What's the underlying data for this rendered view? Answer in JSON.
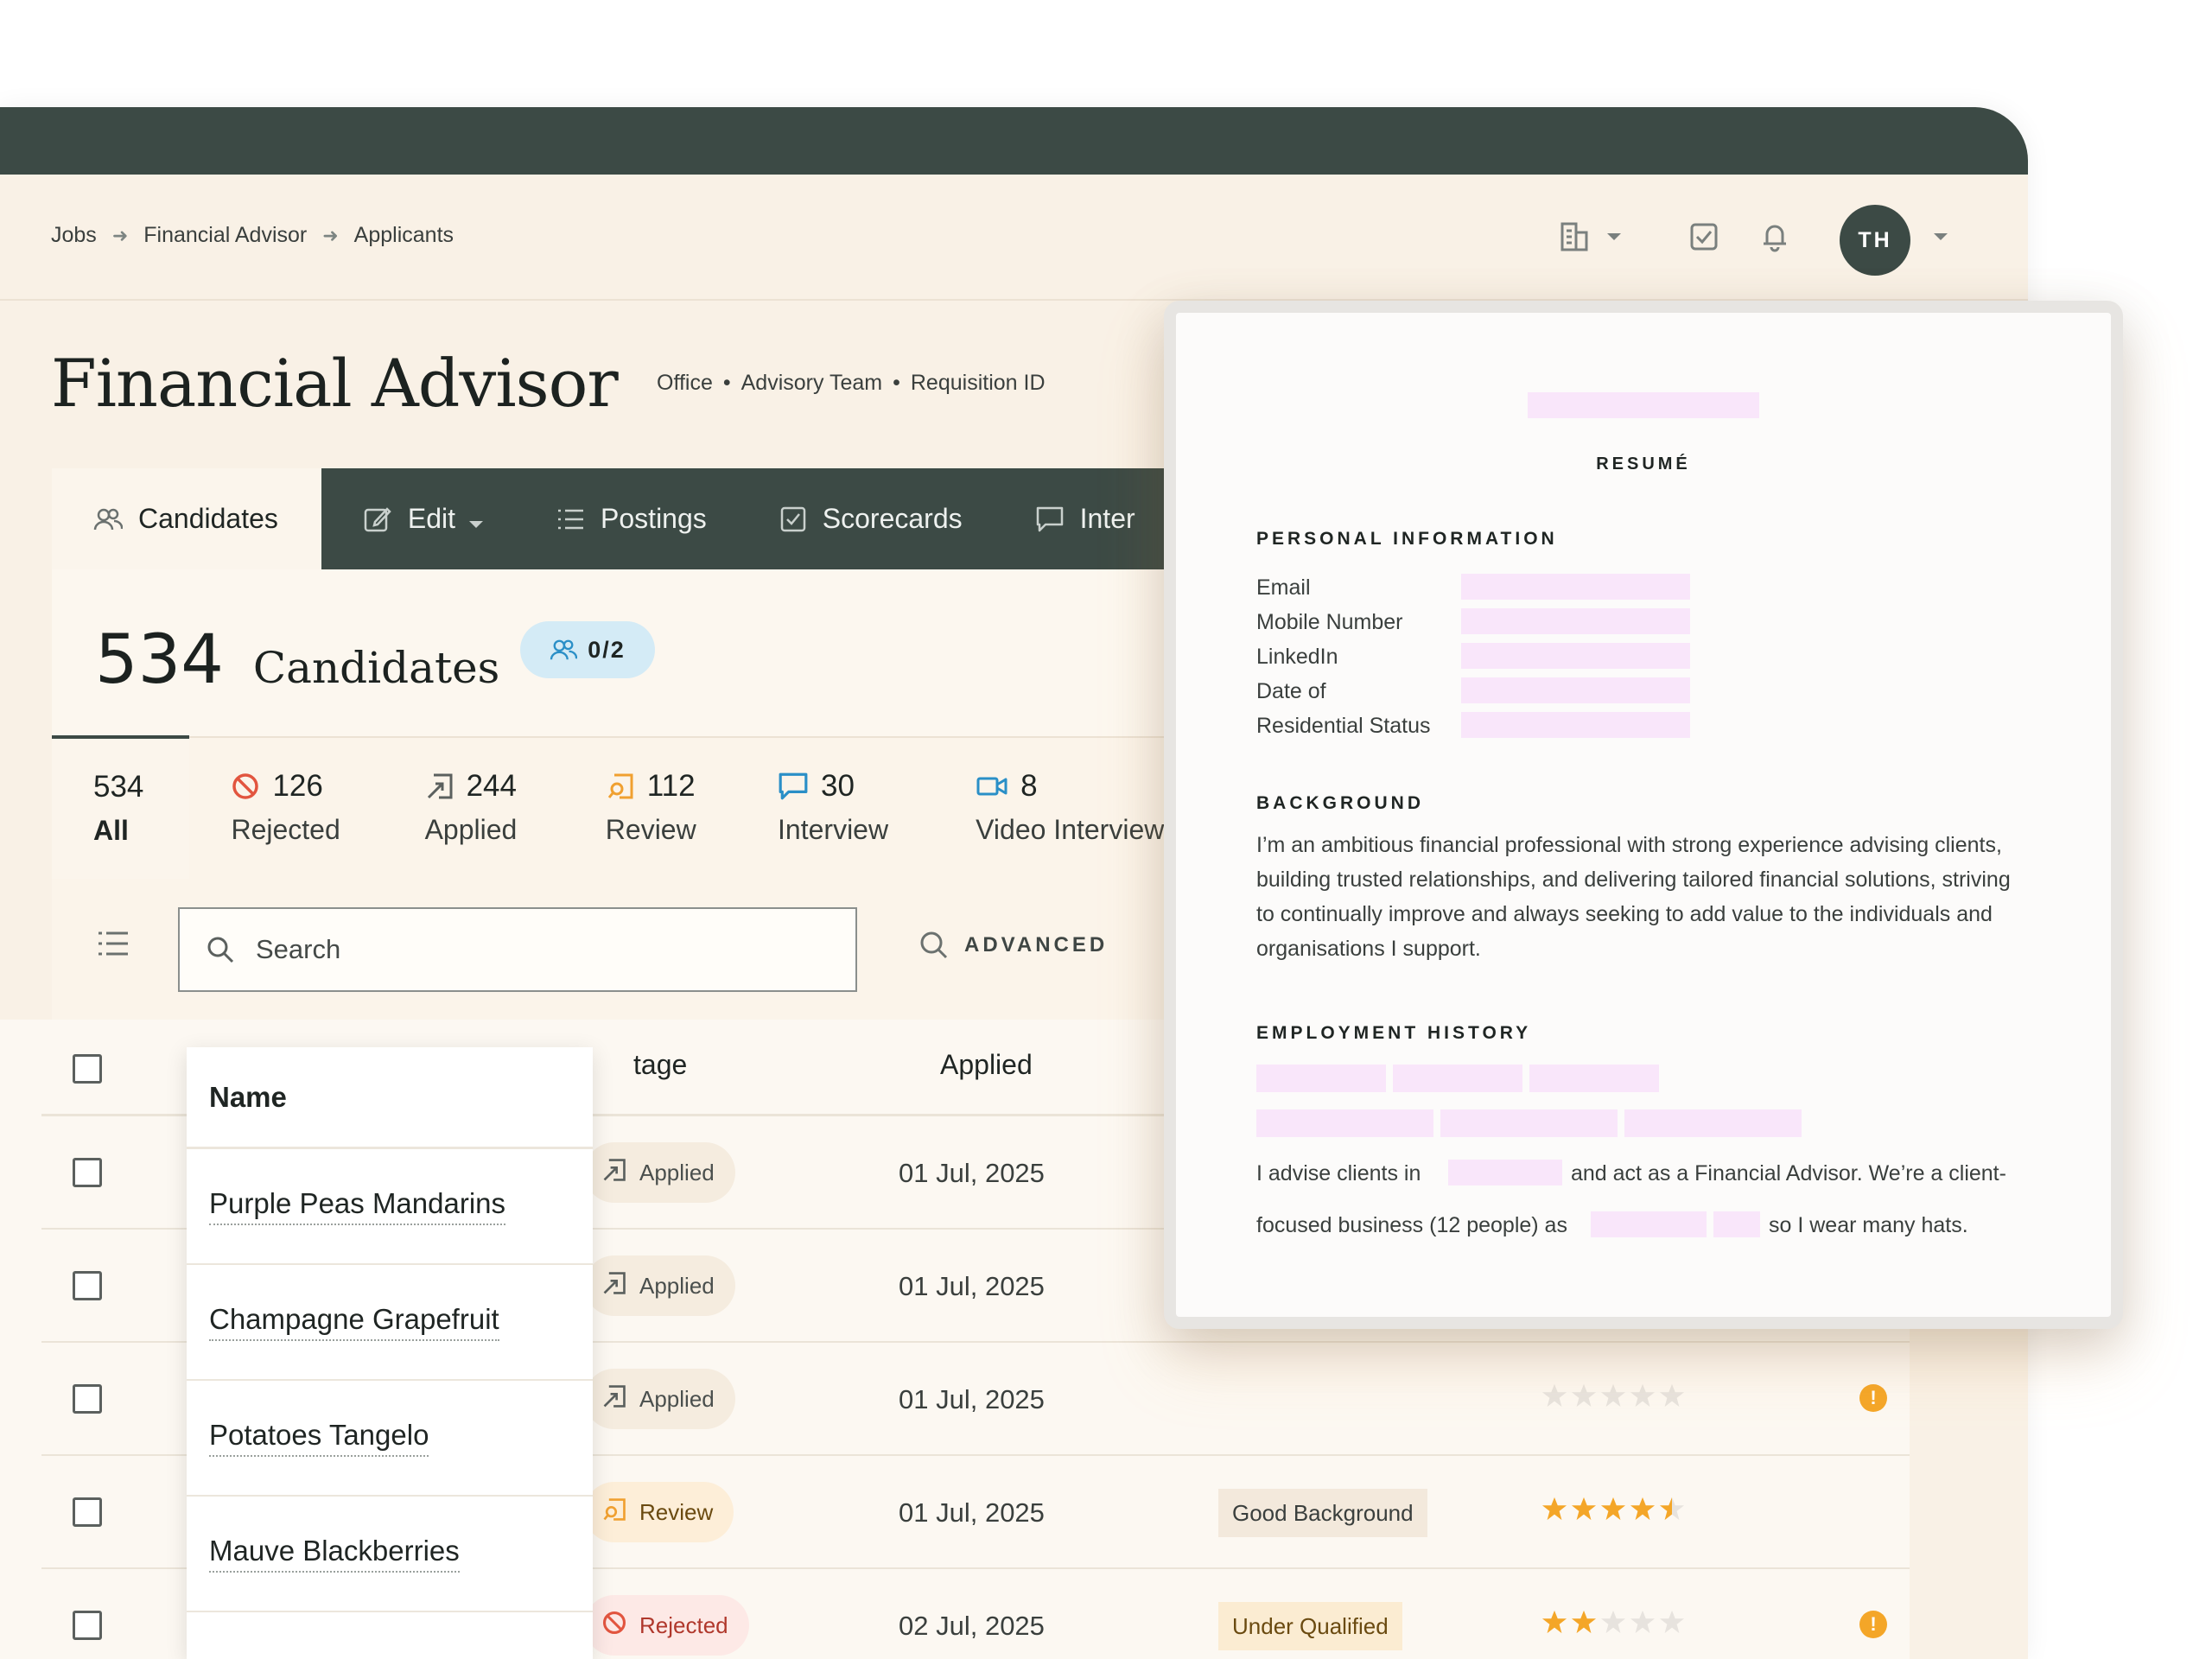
{
  "breadcrumb": {
    "items": [
      "Jobs",
      "Financial Advisor",
      "Applicants"
    ]
  },
  "header": {
    "avatar_initials": "TH"
  },
  "page": {
    "title": "Financial Advisor",
    "meta": [
      "Office",
      "Advisory Team",
      "Requisition ID"
    ]
  },
  "tabs": [
    {
      "label": "Candidates",
      "icon": "users-icon",
      "active": true
    },
    {
      "label": "Edit",
      "icon": "edit-icon"
    },
    {
      "label": "Postings",
      "icon": "list-icon"
    },
    {
      "label": "Scorecards",
      "icon": "checkbox-icon"
    },
    {
      "label": "Inter",
      "icon": "chat-icon"
    }
  ],
  "candidates": {
    "count": "534",
    "label": "Candidates",
    "badge": "0/2"
  },
  "stages": [
    {
      "num": "534",
      "label": "All"
    },
    {
      "num": "126",
      "label": "Rejected",
      "icon": "ban-icon",
      "color": "#e2553f"
    },
    {
      "num": "244",
      "label": "Applied",
      "icon": "applied-icon",
      "color": "#5b605e"
    },
    {
      "num": "112",
      "label": "Review",
      "icon": "review-icon",
      "color": "#f0a030"
    },
    {
      "num": "30",
      "label": "Interview",
      "icon": "chat-icon",
      "color": "#2a8fc7"
    },
    {
      "num": "8",
      "label": "Video Interview",
      "icon": "video-icon",
      "color": "#2a8fc7"
    }
  ],
  "toolbar": {
    "search_placeholder": "Search",
    "advanced_label": "ADVANCED"
  },
  "table": {
    "headers": {
      "name": "Name",
      "stage": "tage",
      "applied": "Applied"
    },
    "rows": [
      {
        "name": "Purple Peas Mandarins",
        "stage": "Applied",
        "stage_type": "applied",
        "date": "01 Jul, 2025",
        "tag": "",
        "rating": null,
        "warn": false
      },
      {
        "name": "Champagne Grapefruit",
        "stage": "Applied",
        "stage_type": "applied",
        "date": "01 Jul, 2025",
        "tag": "",
        "rating": null,
        "warn": false
      },
      {
        "name": "Potatoes Tangelo",
        "stage": "Applied",
        "stage_type": "applied",
        "date": "01 Jul, 2025",
        "tag": "",
        "rating": 0,
        "warn": true
      },
      {
        "name": "Mauve Blackberries",
        "stage": "Review",
        "stage_type": "review",
        "date": "01 Jul, 2025",
        "tag": "Good Background",
        "tag_type": "good",
        "rating": 4.5,
        "warn": false
      },
      {
        "name": "",
        "stage": "Rejected",
        "stage_type": "rejected",
        "date": "02 Jul, 2025",
        "tag": "Under Qualified",
        "tag_type": "under",
        "rating": 2,
        "warn": true
      }
    ]
  },
  "resume": {
    "title": "RESUMÉ",
    "personal_heading": "PERSONAL INFORMATION",
    "fields": [
      "Email",
      "Mobile Number",
      "LinkedIn",
      "Date of",
      "Residential Status"
    ],
    "background_heading": "BACKGROUND",
    "background_text": "I’m an ambitious financial professional with strong experience advising clients, building trusted relationships, and delivering tailored financial solutions, striving to continually improve and always seeking to add value to the individuals and organisations I support.",
    "employment_heading": "EMPLOYMENT HISTORY",
    "employment_line1_a": "I advise clients in",
    "employment_line1_b": "and act as a Financial Advisor. We’re a client-",
    "employment_line2_a": "focused business (12 people) as",
    "employment_line2_b": "so I wear many hats."
  },
  "colors": {
    "dark": "#3c4a45",
    "cream": "#f9f1e6",
    "highlight": "#f9e6fa",
    "star": "#f4a628"
  }
}
